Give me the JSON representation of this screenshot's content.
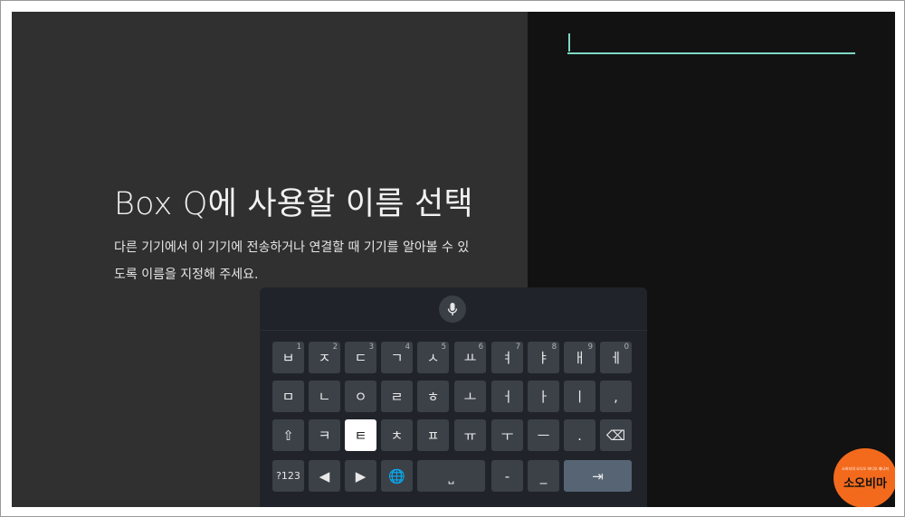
{
  "setup": {
    "title": "Box Q에 사용할 이름 선택",
    "description_line1": "다른 기기에서 이 기기에 전송하거나 연결할 때 기기를 알아볼 수 있",
    "description_line2": "도록 이름을 지정해 주세요."
  },
  "name_input": {
    "value": ""
  },
  "keyboard": {
    "mic_icon": "mic-icon",
    "rows": [
      [
        {
          "label": "ㅂ",
          "hint": "1"
        },
        {
          "label": "ㅈ",
          "hint": "2"
        },
        {
          "label": "ㄷ",
          "hint": "3"
        },
        {
          "label": "ㄱ",
          "hint": "4"
        },
        {
          "label": "ㅅ",
          "hint": "5"
        },
        {
          "label": "ㅛ",
          "hint": "6"
        },
        {
          "label": "ㅕ",
          "hint": "7"
        },
        {
          "label": "ㅑ",
          "hint": "8"
        },
        {
          "label": "ㅐ",
          "hint": "9"
        },
        {
          "label": "ㅔ",
          "hint": "0"
        }
      ],
      [
        {
          "label": "ㅁ"
        },
        {
          "label": "ㄴ"
        },
        {
          "label": "ㅇ"
        },
        {
          "label": "ㄹ"
        },
        {
          "label": "ㅎ"
        },
        {
          "label": "ㅗ"
        },
        {
          "label": "ㅓ"
        },
        {
          "label": "ㅏ"
        },
        {
          "label": "ㅣ"
        },
        {
          "label": ","
        }
      ],
      [
        {
          "label": "⇧",
          "icon": "shift-icon"
        },
        {
          "label": "ㅋ"
        },
        {
          "label": "ㅌ",
          "selected": true
        },
        {
          "label": "ㅊ"
        },
        {
          "label": "ㅍ"
        },
        {
          "label": "ㅠ"
        },
        {
          "label": "ㅜ"
        },
        {
          "label": "ㅡ"
        },
        {
          "label": "."
        },
        {
          "label": "⌫",
          "icon": "backspace-icon"
        }
      ],
      [
        {
          "label": "?123"
        },
        {
          "label": "◀",
          "icon": "arrow-left-icon"
        },
        {
          "label": "▶",
          "icon": "arrow-right-icon"
        },
        {
          "label": "🌐",
          "icon": "globe-icon"
        },
        {
          "label": "⎵",
          "icon": "space-icon",
          "wide": true
        },
        {
          "label": "-"
        },
        {
          "label": "_"
        },
        {
          "label": "⇥",
          "icon": "enter-icon",
          "wide": true
        }
      ]
    ]
  },
  "watermark": {
    "small": "소비자의 오디오 비디오 매니저",
    "brand": "소오비마"
  },
  "colors": {
    "accent": "#7fd6c4",
    "selected_key": "#ffffff",
    "enter_key": "#566474"
  }
}
